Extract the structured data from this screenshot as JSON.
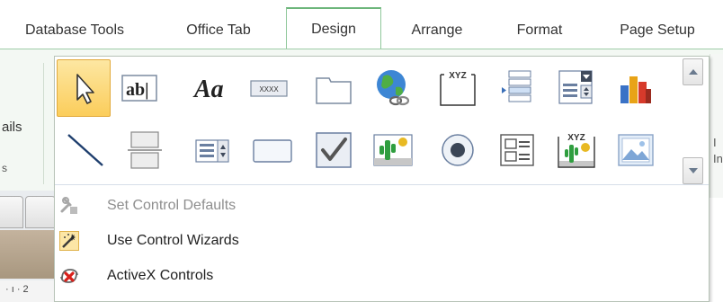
{
  "tabs": [
    {
      "label": "Database Tools",
      "active": false
    },
    {
      "label": "Office Tab",
      "active": false
    },
    {
      "label": "Design",
      "active": true
    },
    {
      "label": "Arrange",
      "active": false
    },
    {
      "label": "Format",
      "active": false
    },
    {
      "label": "Page Setup",
      "active": false
    }
  ],
  "ribbon": {
    "left_group_label": "ails",
    "left_fragment": "s",
    "right_fragment_1": "I",
    "right_fragment_2": "In"
  },
  "ruler_text": "· ı · 2",
  "gallery": {
    "row1": [
      {
        "icon": "select-pointer-icon",
        "selected": true
      },
      {
        "icon": "text-box-icon",
        "text": "ab|"
      },
      {
        "icon": "label-icon",
        "text": "Aa"
      },
      {
        "icon": "button-icon",
        "text": "XXXX"
      },
      {
        "icon": "tab-control-icon"
      },
      {
        "icon": "hyperlink-icon"
      },
      {
        "icon": "web-browser-control-icon",
        "text": "XYZ"
      },
      {
        "icon": "navigation-control-icon"
      },
      {
        "icon": "combo-box-icon"
      },
      {
        "icon": "chart-icon"
      }
    ],
    "row2": [
      {
        "icon": "line-icon"
      },
      {
        "icon": "page-break-icon"
      },
      {
        "icon": "list-box-icon"
      },
      {
        "icon": "rectangle-icon"
      },
      {
        "icon": "check-box-icon"
      },
      {
        "icon": "unbound-object-frame-icon"
      },
      {
        "icon": "option-button-icon"
      },
      {
        "icon": "option-group-icon"
      },
      {
        "icon": "bound-object-frame-icon",
        "text": "XYZ"
      },
      {
        "icon": "image-icon"
      }
    ]
  },
  "menu": [
    {
      "label": "Set Control Defaults",
      "icon": "set-defaults-icon",
      "disabled": true
    },
    {
      "label": "Use Control Wizards",
      "icon": "control-wizards-icon",
      "disabled": false
    },
    {
      "label": "ActiveX Controls",
      "icon": "activex-icon",
      "disabled": false
    }
  ],
  "colors": {
    "accent_green": "#6cb57a",
    "selected_fill": "#fbcd5b",
    "activex_red": "#d9201b"
  }
}
